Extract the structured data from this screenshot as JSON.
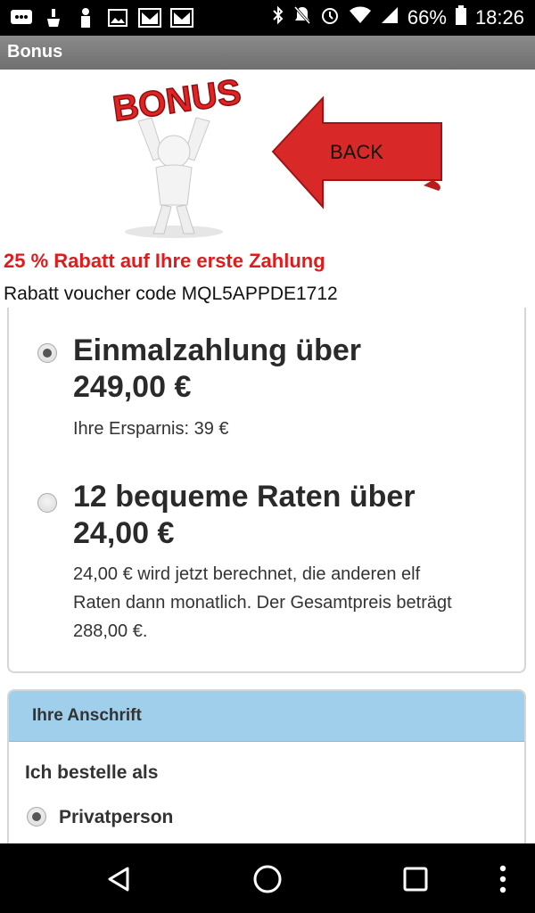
{
  "status_bar": {
    "battery": "66%",
    "time": "18:26",
    "icons": [
      "message-icon",
      "cleaner-icon",
      "person-icon",
      "image-icon",
      "gmail-icon",
      "gmail-icon",
      "bluetooth-icon",
      "mute-icon",
      "alarm-icon",
      "wifi-icon",
      "signal-icon",
      "battery-icon"
    ]
  },
  "titlebar": {
    "title": "Bonus"
  },
  "banner": {
    "bonus_text": "BONUS",
    "back_label": "BACK"
  },
  "promo": {
    "headline": "25 % Rabatt auf Ihre erste Zahlung",
    "voucher": "Rabatt voucher code MQL5APPDE1712"
  },
  "payment": {
    "options": [
      {
        "title_line1": "Einmalzahlung über",
        "title_line2": "249,00 €",
        "note": "Ihre Ersparnis: 39 €",
        "selected": true
      },
      {
        "title_line1": "12 bequeme Raten über",
        "title_line2": "24,00 €",
        "note_line1": "24,00 € wird jetzt berechnet, die anderen elf",
        "note_line2": "Raten dann monatlich. Der Gesamtpreis beträgt",
        "note_line3": "288,00 €.",
        "selected": false
      }
    ]
  },
  "address": {
    "header": "Ihre Anschrift",
    "question": "Ich bestelle als",
    "option": "Privatperson"
  },
  "colors": {
    "promo": "#e11b1b",
    "address_header": "#9fcfea",
    "back_arrow": "#d82828"
  }
}
